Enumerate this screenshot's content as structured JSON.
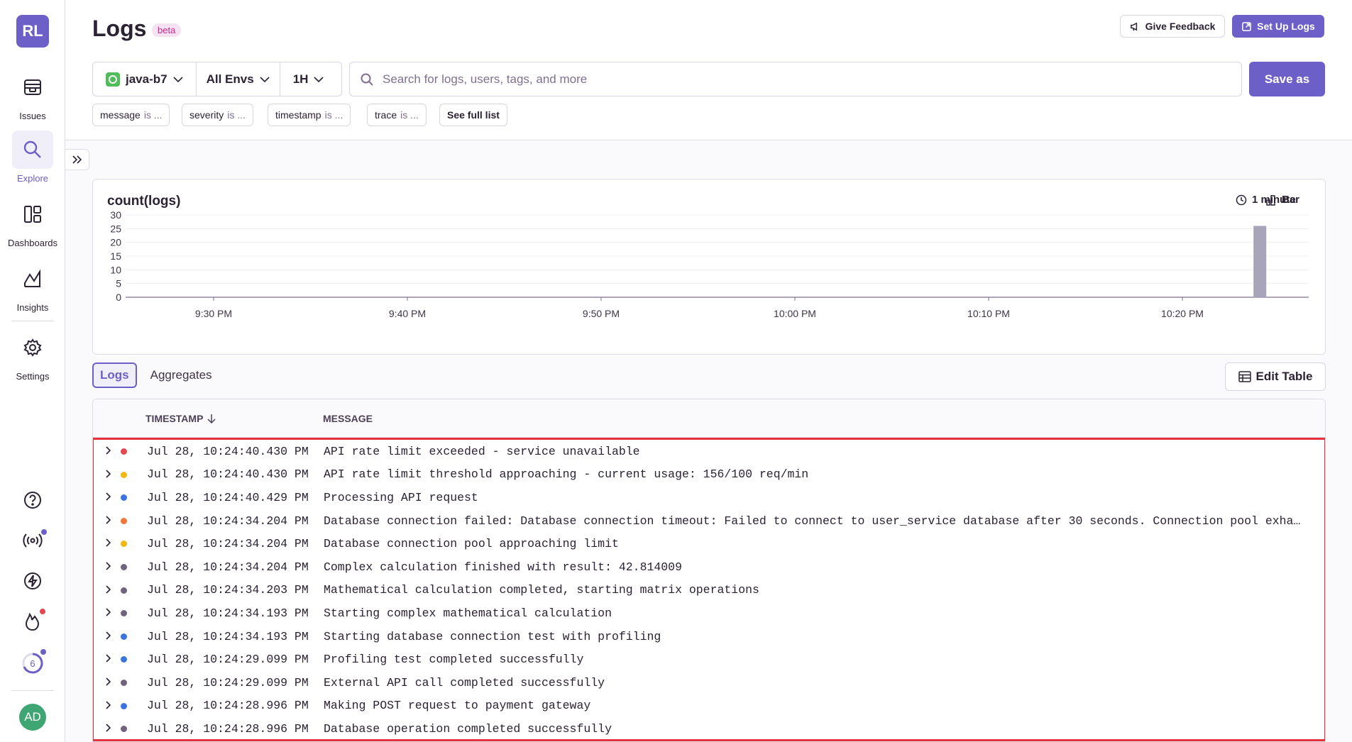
{
  "sidebar": {
    "org_initials": "RL",
    "items": [
      {
        "label": "Issues",
        "icon": "issues-icon"
      },
      {
        "label": "Explore",
        "icon": "search-icon"
      },
      {
        "label": "Dashboards",
        "icon": "dashboards-icon"
      },
      {
        "label": "Insights",
        "icon": "insights-icon"
      },
      {
        "label": "Settings",
        "icon": "gear-icon"
      }
    ],
    "onboarding_count": "6",
    "user_initials": "AD"
  },
  "header": {
    "title": "Logs",
    "badge": "beta",
    "feedback_label": "Give Feedback",
    "setup_label": "Set Up Logs",
    "project": "java-b7",
    "environment": "All Envs",
    "time_range": "1H",
    "search_placeholder": "Search for logs, users, tags, and more",
    "save_label": "Save as",
    "chips": [
      {
        "key": "message",
        "op": "is ..."
      },
      {
        "key": "severity",
        "op": "is ..."
      },
      {
        "key": "timestamp",
        "op": "is ..."
      },
      {
        "key": "trace",
        "op": "is ..."
      }
    ],
    "see_full_list": "See full list"
  },
  "chart_controls": {
    "type_label": "Bar",
    "interval_label": "1 minute"
  },
  "chart_data": {
    "type": "bar",
    "title": "count(logs)",
    "ylim": [
      0,
      30
    ],
    "yticks": [
      "30",
      "25",
      "20",
      "15",
      "10",
      "5",
      "0"
    ],
    "xticks": [
      "9:30 PM",
      "9:40 PM",
      "9:50 PM",
      "10:00 PM",
      "10:10 PM",
      "10:20 PM"
    ],
    "bars": [
      {
        "time": "10:24 PM",
        "value": 26
      }
    ],
    "bar_color": "#a8a4ba",
    "grid": true
  },
  "tabs": {
    "logs": "Logs",
    "aggregates": "Aggregates"
  },
  "edit_table_label": "Edit Table",
  "table": {
    "columns": {
      "timestamp": "TIMESTAMP",
      "message": "MESSAGE"
    },
    "rows": [
      {
        "severity": "#e5474f",
        "ts": "Jul 28, 10:24:40.430 PM",
        "msg": "API rate limit exceeded - service unavailable"
      },
      {
        "severity": "#f2b712",
        "ts": "Jul 28, 10:24:40.430 PM",
        "msg": "API rate limit threshold approaching - current usage: 156/100 req/min"
      },
      {
        "severity": "#3c74dd",
        "ts": "Jul 28, 10:24:40.429 PM",
        "msg": "Processing API request"
      },
      {
        "severity": "#f0763b",
        "ts": "Jul 28, 10:24:34.204 PM",
        "msg": "Database connection failed: Database connection timeout: Failed to connect to user_service database after 30 seconds. Connection pool exhausted"
      },
      {
        "severity": "#f2b712",
        "ts": "Jul 28, 10:24:34.204 PM",
        "msg": "Database connection pool approaching limit"
      },
      {
        "severity": "#71637e",
        "ts": "Jul 28, 10:24:34.204 PM",
        "msg": "Complex calculation finished with result: 42.814009"
      },
      {
        "severity": "#71637e",
        "ts": "Jul 28, 10:24:34.203 PM",
        "msg": "Mathematical calculation completed, starting matrix operations"
      },
      {
        "severity": "#71637e",
        "ts": "Jul 28, 10:24:34.193 PM",
        "msg": "Starting complex mathematical calculation"
      },
      {
        "severity": "#3c74dd",
        "ts": "Jul 28, 10:24:34.193 PM",
        "msg": "Starting database connection test with profiling"
      },
      {
        "severity": "#3c74dd",
        "ts": "Jul 28, 10:24:29.099 PM",
        "msg": "Profiling test completed successfully"
      },
      {
        "severity": "#71637e",
        "ts": "Jul 28, 10:24:29.099 PM",
        "msg": "External API call completed successfully"
      },
      {
        "severity": "#3c74dd",
        "ts": "Jul 28, 10:24:28.996 PM",
        "msg": "Making POST request to payment gateway"
      },
      {
        "severity": "#71637e",
        "ts": "Jul 28, 10:24:28.996 PM",
        "msg": "Database operation completed successfully"
      }
    ]
  },
  "colors": {
    "accent": "#6c5fc7",
    "highlight_border": "#e8313f"
  }
}
